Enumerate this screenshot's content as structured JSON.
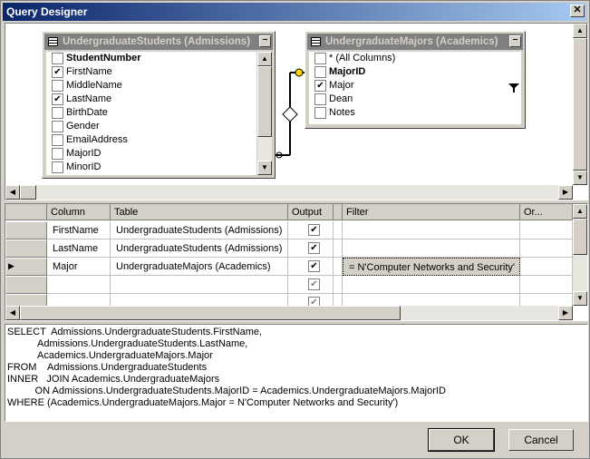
{
  "window": {
    "title": "Query Designer",
    "close_glyph": "✕"
  },
  "tables": [
    {
      "title": "UndergraduateStudents (Admissions)",
      "columns": [
        {
          "label": "StudentNumber",
          "checked": false,
          "bold": true
        },
        {
          "label": "FirstName",
          "checked": true,
          "bold": false
        },
        {
          "label": "MiddleName",
          "checked": false,
          "bold": false
        },
        {
          "label": "LastName",
          "checked": true,
          "bold": false
        },
        {
          "label": "BirthDate",
          "checked": false,
          "bold": false
        },
        {
          "label": "Gender",
          "checked": false,
          "bold": false
        },
        {
          "label": "EmailAddress",
          "checked": false,
          "bold": false
        },
        {
          "label": "MajorID",
          "checked": false,
          "bold": false
        },
        {
          "label": "MinorID",
          "checked": false,
          "bold": false
        }
      ]
    },
    {
      "title": "UndergraduateMajors (Academics)",
      "columns": [
        {
          "label": "* (All Columns)",
          "checked": false,
          "bold": false
        },
        {
          "label": "MajorID",
          "checked": false,
          "bold": true
        },
        {
          "label": "Major",
          "checked": true,
          "bold": false
        },
        {
          "label": "Dean",
          "checked": false,
          "bold": false
        },
        {
          "label": "Notes",
          "checked": false,
          "bold": false
        }
      ]
    }
  ],
  "grid": {
    "headers": [
      "Column",
      "Table",
      "Output",
      "Filter",
      "Or..."
    ],
    "rows": [
      {
        "column": "FirstName",
        "table": "UndergraduateStudents (Admissions)",
        "output": true,
        "filter": "",
        "current": false
      },
      {
        "column": "LastName",
        "table": "UndergraduateStudents (Admissions)",
        "output": true,
        "filter": "",
        "current": false
      },
      {
        "column": "Major",
        "table": "UndergraduateMajors (Academics)",
        "output": true,
        "filter": "= N'Computer Networks and Security'",
        "current": true
      },
      {
        "column": "",
        "table": "",
        "output": true,
        "filter": "",
        "current": false
      },
      {
        "column": "",
        "table": "",
        "output": true,
        "filter": "",
        "current": false
      }
    ]
  },
  "sql": [
    "SELECT  Admissions.UndergraduateStudents.FirstName,",
    "           Admissions.UndergraduateStudents.LastName,",
    "           Academics.UndergraduateMajors.Major",
    "FROM    Admissions.UndergraduateStudents",
    "INNER   JOIN Academics.UndergraduateMajors",
    "          ON Admissions.UndergraduateStudents.MajorID = Academics.UndergraduateMajors.MajorID",
    "WHERE (Academics.UndergraduateMajors.Major = N'Computer Networks and Security')"
  ],
  "buttons": {
    "ok": "OK",
    "cancel": "Cancel"
  },
  "icons": {
    "filter": "filter-icon",
    "row_pointer": "▶",
    "minimize": "–",
    "scroll_up": "▲",
    "scroll_down": "▼",
    "scroll_left": "◀",
    "scroll_right": "▶"
  },
  "colors": {
    "title_gradient_start": "#0a246a",
    "title_gradient_end": "#a6caf0",
    "face": "#d4d0c8"
  }
}
